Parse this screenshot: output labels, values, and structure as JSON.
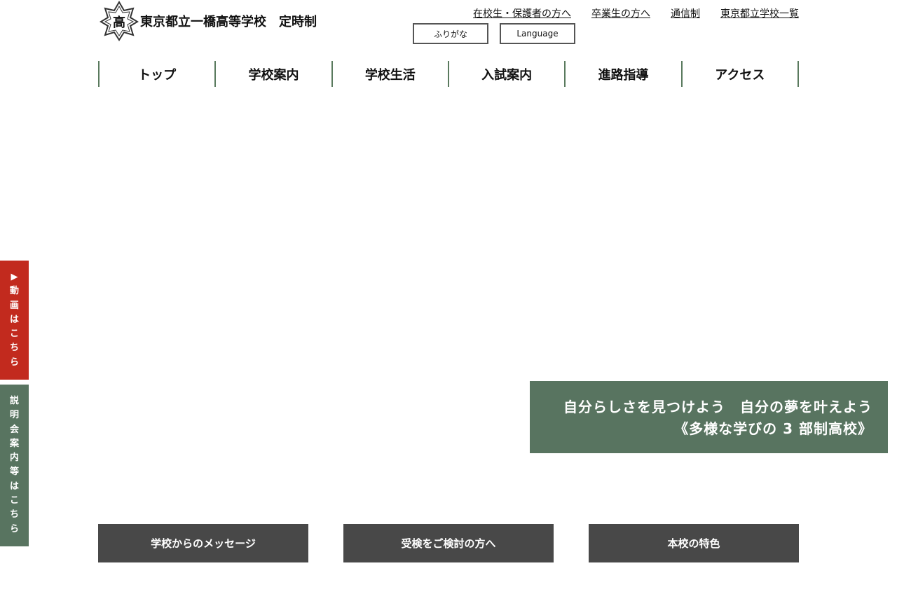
{
  "header": {
    "logo_text": "高",
    "school_name": "東京都立一橋高等学校　定時制",
    "util_links": [
      "在校生・保護者の方へ",
      "卒業生の方へ",
      "通信制",
      "東京都立学校一覧"
    ],
    "furigana_label": "ふりがな",
    "language_label": "Language"
  },
  "nav": {
    "items": [
      "トップ",
      "学校案内",
      "学校生活",
      "入試案内",
      "進路指導",
      "アクセス"
    ]
  },
  "hero": {
    "line1": "自分らしさを見つけよう　自分の夢を叶えよう",
    "line2": "《多様な学びの 3 部制高校》"
  },
  "side_tabs": {
    "video": [
      "▶",
      "動",
      "画",
      "は",
      "こ",
      "ち",
      "ら"
    ],
    "info": [
      "説",
      "明",
      "会",
      "案",
      "内",
      "等",
      "は",
      "こ",
      "ち",
      "ら"
    ]
  },
  "cta": {
    "message": "学校からのメッセージ",
    "applicants": "受検をご検討の方へ",
    "features": "本校の特色"
  },
  "colors": {
    "accent_green": "#587460",
    "accent_red": "#c22a1e",
    "cta_gray": "#484848"
  }
}
